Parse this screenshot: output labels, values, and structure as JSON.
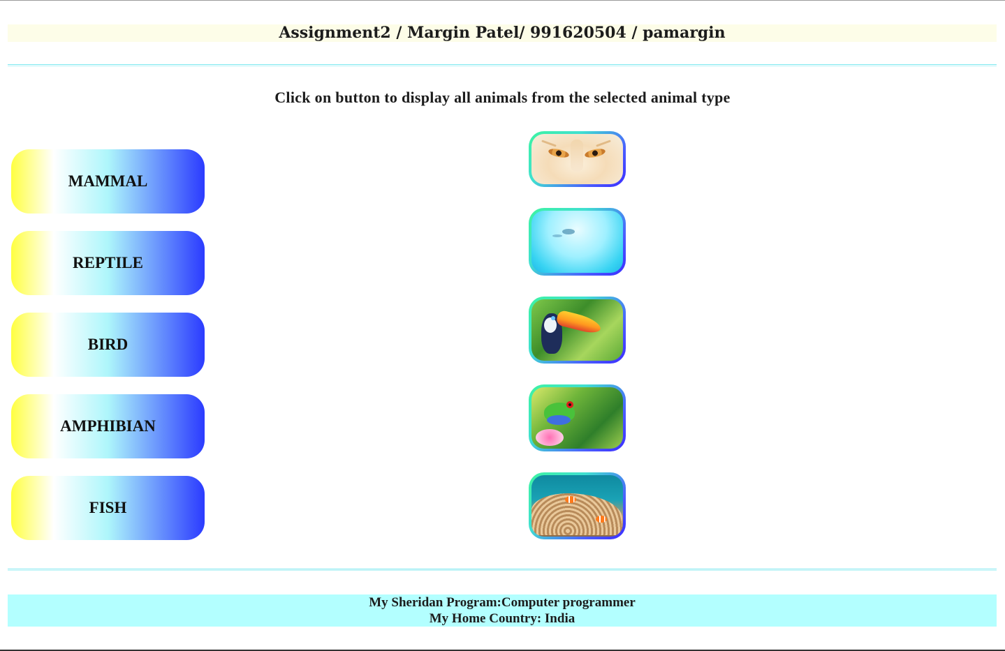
{
  "header": {
    "title": "Assignment2 / Margin Patel/ 991620504 / pamargin"
  },
  "instruction": "Click on button to display all animals from the selected animal type",
  "animal_types": [
    {
      "label": "MAMMAL"
    },
    {
      "label": "REPTILE"
    },
    {
      "label": "BIRD"
    },
    {
      "label": "AMPHIBIAN"
    },
    {
      "label": "FISH"
    }
  ],
  "thumbnails": [
    {
      "icon": "tiger-eyes-image"
    },
    {
      "icon": "underwater-turtle-image"
    },
    {
      "icon": "toucan-image"
    },
    {
      "icon": "tree-frog-image"
    },
    {
      "icon": "clownfish-image"
    }
  ],
  "footer": {
    "program": "My Sheridan Program:Computer programmer",
    "country": "My Home Country: India"
  },
  "colors": {
    "header_bg": "#fdfde8",
    "footer_bg": "#b3ffff",
    "button_gradient_start": "#ffff40",
    "button_gradient_end": "#2b3bff",
    "rule": "#7ee8f0"
  }
}
